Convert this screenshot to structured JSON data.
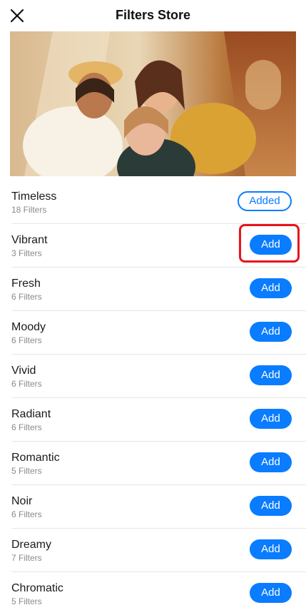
{
  "header": {
    "title": "Filters Store"
  },
  "colors": {
    "accent": "#0a7cff",
    "highlight": "#e8131b"
  },
  "hero": {
    "icon": "photo-of-three-friends"
  },
  "filters": [
    {
      "name": "Timeless",
      "count": "18 Filters",
      "action": "Added",
      "state": "added"
    },
    {
      "name": "Vibrant",
      "count": "3 Filters",
      "action": "Add",
      "state": "add"
    },
    {
      "name": "Fresh",
      "count": "6 Filters",
      "action": "Add",
      "state": "add"
    },
    {
      "name": "Moody",
      "count": "6 Filters",
      "action": "Add",
      "state": "add"
    },
    {
      "name": "Vivid",
      "count": "6 Filters",
      "action": "Add",
      "state": "add"
    },
    {
      "name": "Radiant",
      "count": "6 Filters",
      "action": "Add",
      "state": "add"
    },
    {
      "name": "Romantic",
      "count": "5 Filters",
      "action": "Add",
      "state": "add"
    },
    {
      "name": "Noir",
      "count": "6 Filters",
      "action": "Add",
      "state": "add"
    },
    {
      "name": "Dreamy",
      "count": "7 Filters",
      "action": "Add",
      "state": "add"
    },
    {
      "name": "Chromatic",
      "count": "5 Filters",
      "action": "Add",
      "state": "add"
    }
  ]
}
